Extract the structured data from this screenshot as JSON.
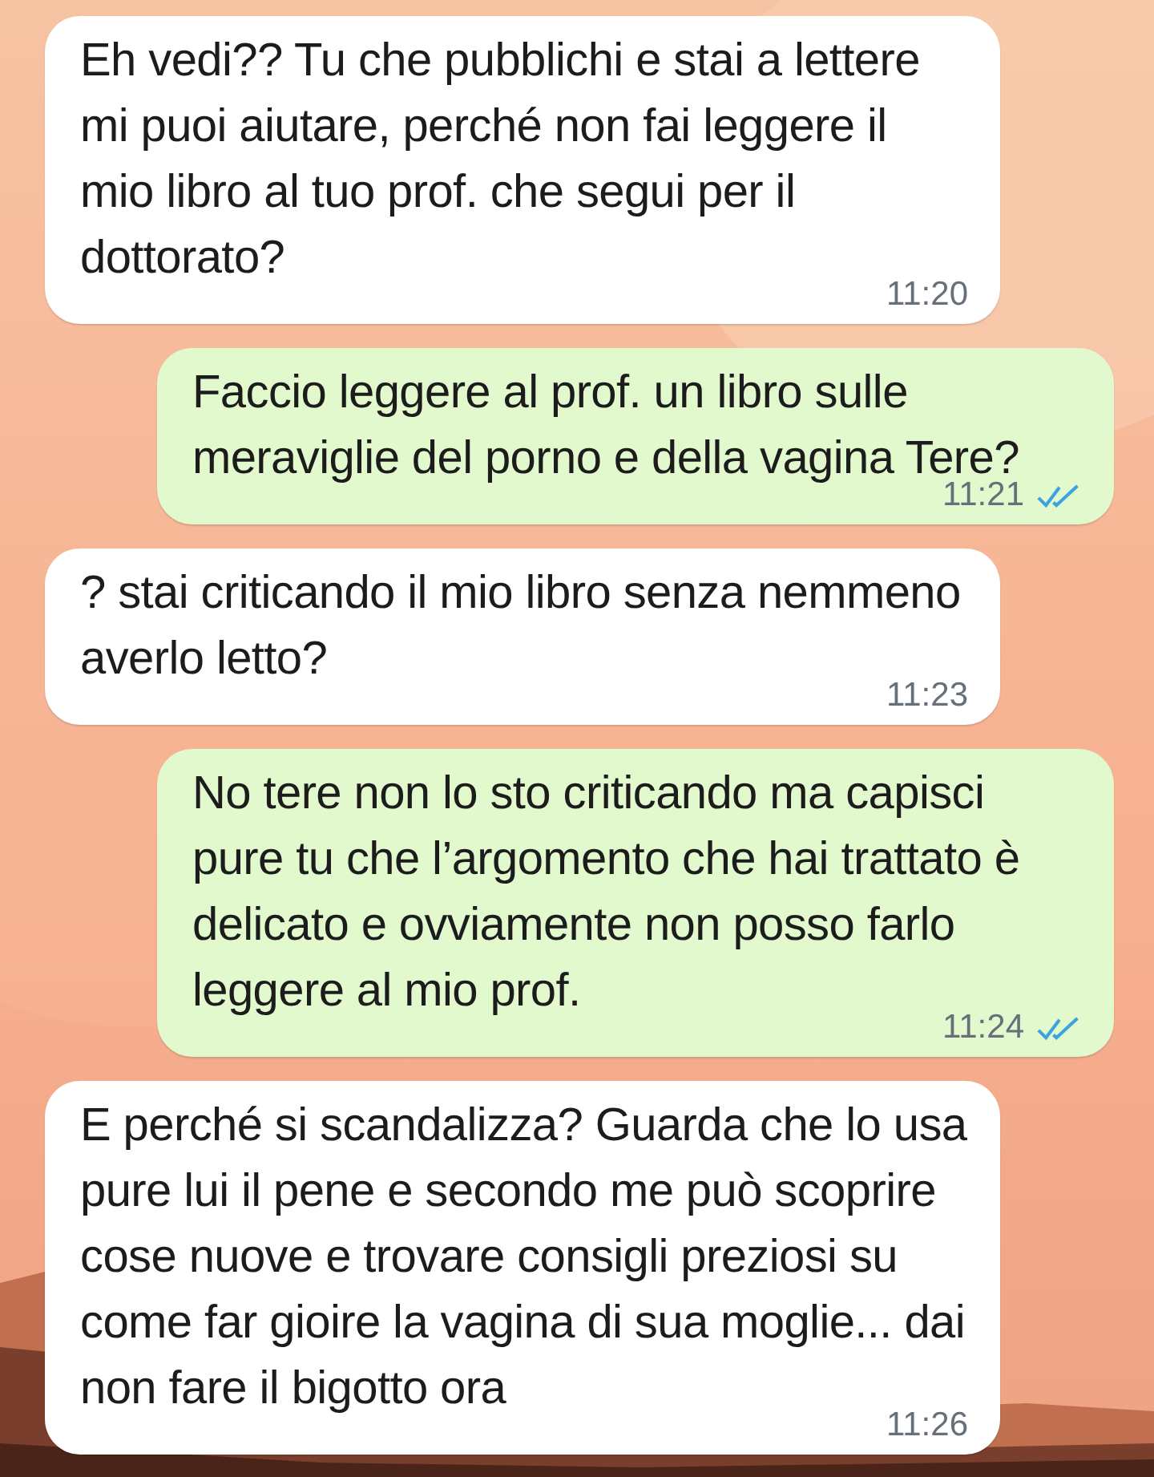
{
  "messages": [
    {
      "kind": "in",
      "text": "Eh vedi?? Tu che pubblichi e stai a lettere mi puoi aiutare, perché non fai leggere il mio libro al tuo prof. che segui per il dottorato?",
      "time": "11:20"
    },
    {
      "kind": "out",
      "text": "Faccio leggere al prof. un libro sulle meraviglie del porno e della vagina Tere?",
      "time": "11:21",
      "read": true
    },
    {
      "kind": "in",
      "text": "? stai criticando il mio libro senza nemmeno averlo letto?",
      "time": "11:23"
    },
    {
      "kind": "out",
      "text": "No tere non lo sto criticando ma capisci pure tu che l’argomento che hai trattato è delicato e ovviamente non posso farlo leggere al mio prof.",
      "time": "11:24",
      "read": true
    },
    {
      "kind": "in",
      "text": "E perché si scandalizza? Guarda che lo usa pure lui il pene e secondo me può scoprire cose nuove e trovare consigli preziosi su come far gioire la vagina di sua moglie... dai non fare il bigotto ora",
      "time": "11:26"
    }
  ]
}
